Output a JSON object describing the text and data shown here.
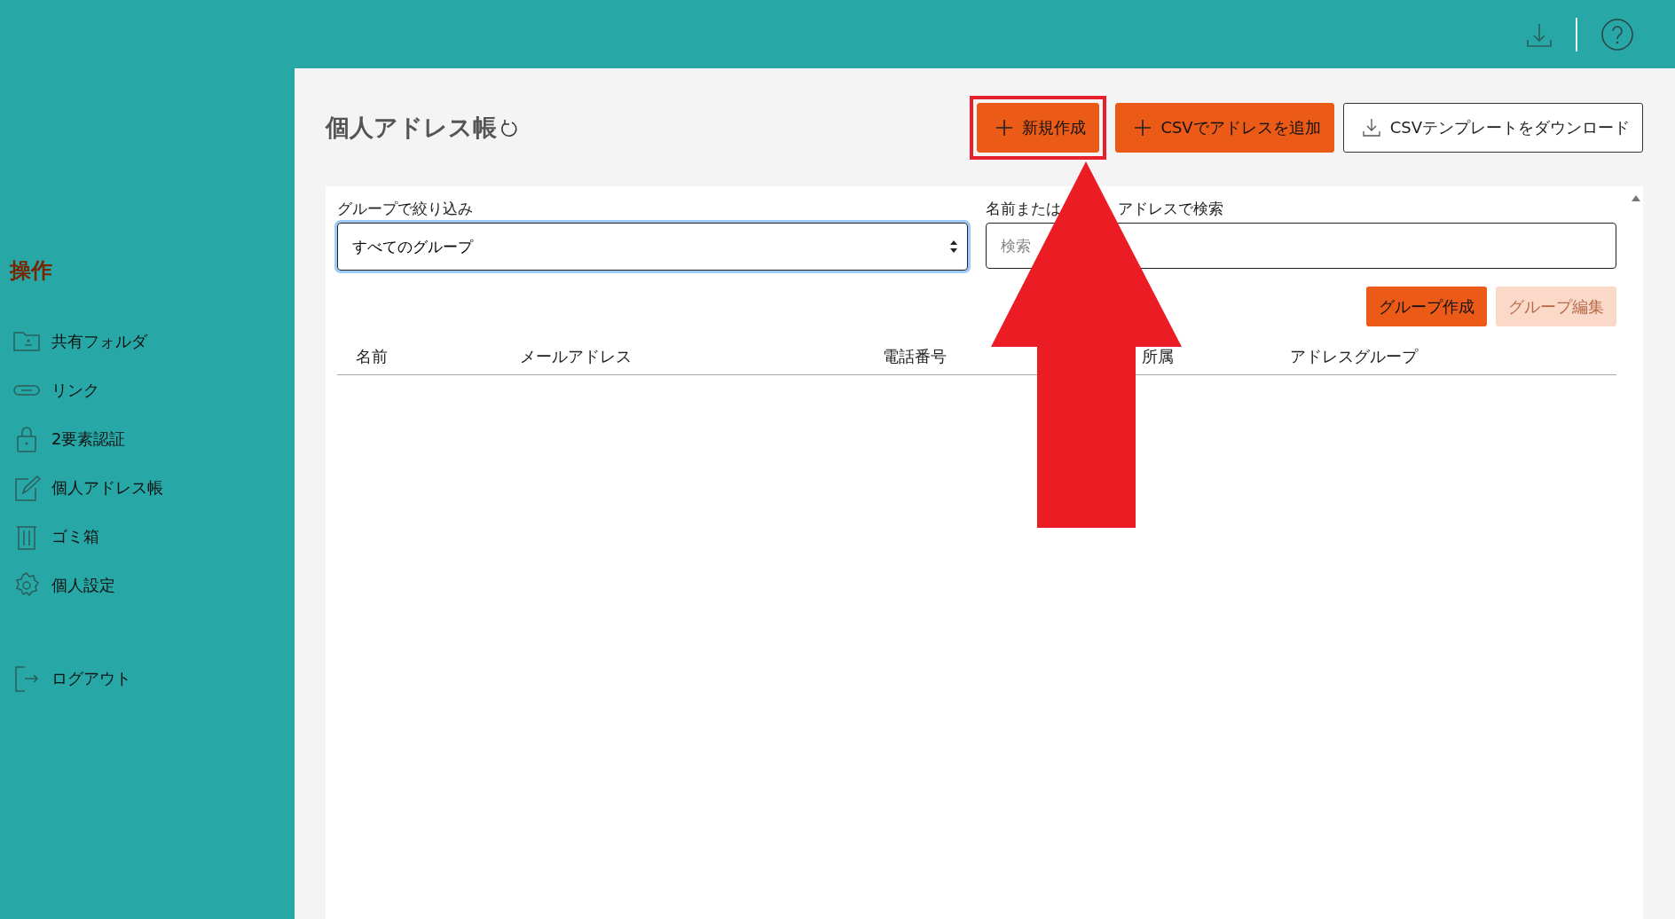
{
  "sidebar": {
    "heading": "操作",
    "items": [
      {
        "kind": "folder",
        "label": "共有フォルダ"
      },
      {
        "kind": "link",
        "label": "リンク"
      },
      {
        "kind": "lock",
        "label": "2要素認証"
      },
      {
        "kind": "edit",
        "label": "個人アドレス帳"
      },
      {
        "kind": "trash",
        "label": "ゴミ箱"
      },
      {
        "kind": "gear",
        "label": "個人設定"
      }
    ],
    "logout": {
      "kind": "logout",
      "label": "ログアウト"
    }
  },
  "page": {
    "title": "個人アドレス帳"
  },
  "actions": [
    {
      "kind": "plus",
      "label": "新規作成",
      "primary": true,
      "highlighted": true
    },
    {
      "kind": "plus",
      "label": "CSVでアドレスを追加",
      "primary": true,
      "highlighted": false
    },
    {
      "kind": "download",
      "label": "CSVテンプレートをダウンロード",
      "primary": false,
      "highlighted": false
    }
  ],
  "filter": {
    "label": "グループで絞り込み",
    "value": "すべてのグループ"
  },
  "search": {
    "label_parts": [
      "名前または",
      "アドレスで検索"
    ],
    "placeholder": "検索"
  },
  "group_buttons": [
    {
      "label": "グループ作成",
      "disabled": false
    },
    {
      "label": "グループ編集",
      "disabled": true
    }
  ],
  "table": {
    "columns": [
      "名前",
      "メールアドレス",
      "電話番号",
      "所属",
      "アドレスグループ"
    ]
  }
}
